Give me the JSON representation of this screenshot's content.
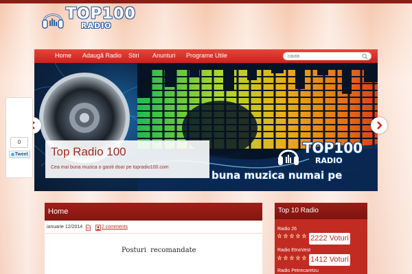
{
  "brand": {
    "logo_top": "TOP100",
    "logo_bottom": "RADIO"
  },
  "nav": {
    "items": [
      {
        "label": "Home"
      },
      {
        "label": "Adaugă Radio"
      },
      {
        "label": "Stiri"
      },
      {
        "label": "Anunturi"
      },
      {
        "label": "Programe Utile"
      }
    ],
    "search": {
      "placeholder": "cauta",
      "value": ""
    }
  },
  "slider": {
    "caption_title": "Top Radio 100",
    "caption_text": "Cea mai buna muzica o gasiti doar pe topradio100.com",
    "logo_top": "TOP100",
    "logo_bottom": "RADIO",
    "tagline": "buna muzica numai pe"
  },
  "share": {
    "count": "0",
    "tweet_label": "Tweet"
  },
  "post": {
    "title": "Home",
    "date": "ianuarie 12/2014",
    "comments": "2 comments",
    "heading": "Posturi recomandate"
  },
  "sidebar": {
    "title": "Top 10 Radio",
    "radios": [
      {
        "name": "Radio 26",
        "votes": "2222 Voturi"
      },
      {
        "name": "Radio EtnoVest",
        "votes": "1412 Voturi"
      },
      {
        "name": "Radio Petrecaretzu",
        "votes": ""
      }
    ]
  },
  "colors": {
    "accent_red": "#c12b22",
    "dark_red": "#841610",
    "link_blue": "#2f5fa4"
  },
  "icons": [
    "headphones-icon",
    "search-icon",
    "chevron-left-icon",
    "chevron-right-icon",
    "document-icon",
    "user-icon",
    "star-icon",
    "twitter-bird-icon"
  ]
}
